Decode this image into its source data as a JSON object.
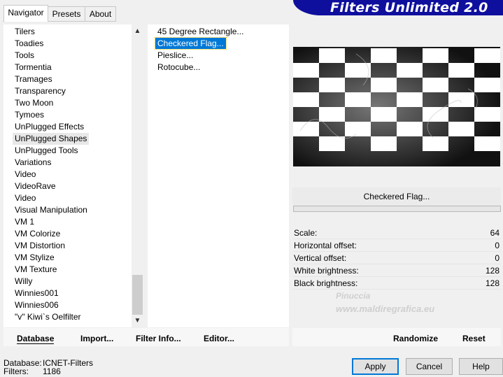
{
  "tabs": [
    "Navigator",
    "Presets",
    "About"
  ],
  "banner_title": "Filters Unlimited 2.0",
  "categories": [
    "Tilers",
    "Toadies",
    "Tools",
    "Tormentia",
    "Tramages",
    "Transparency",
    "Two Moon",
    "Tymoes",
    "UnPlugged Effects",
    "UnPlugged Shapes",
    "UnPlugged Tools",
    "Variations",
    "Video",
    "VideoRave",
    "Video",
    "Visual Manipulation",
    "VM 1",
    "VM Colorize",
    "VM Distortion",
    "VM Stylize",
    "VM Texture",
    "Willy",
    "Winnies001",
    "Winnies006",
    "\"v\" Kiwi`s Oelfilter"
  ],
  "selected_category_index": 9,
  "filters": [
    "45 Degree Rectangle...",
    "Checkered Flag...",
    "Pieslice...",
    "Rotocube..."
  ],
  "selected_filter_index": 1,
  "selected_filter_name": "Checkered Flag...",
  "parameters": [
    {
      "label": "Scale:",
      "value": "64"
    },
    {
      "label": "Horizontal offset:",
      "value": "0"
    },
    {
      "label": "Vertical offset:",
      "value": "0"
    },
    {
      "label": "White brightness:",
      "value": "128"
    },
    {
      "label": "Black brightness:",
      "value": "128"
    }
  ],
  "watermark": {
    "line1": "Pinuccia",
    "line2": "www.maldiregrafica.eu"
  },
  "left_buttons": {
    "database": "Database",
    "import": "Import...",
    "filter_info": "Filter Info...",
    "editor": "Editor..."
  },
  "right_buttons": {
    "randomize": "Randomize",
    "reset": "Reset"
  },
  "status": {
    "database_label": "Database:",
    "database_value": "ICNET-Filters",
    "filters_label": "Filters:",
    "filters_value": "1186"
  },
  "dialog": {
    "apply": "Apply",
    "cancel": "Cancel",
    "help": "Help"
  },
  "scroll_icons": {
    "up": "scroll-up-arrow-icon",
    "down": "scroll-down-arrow-icon"
  }
}
